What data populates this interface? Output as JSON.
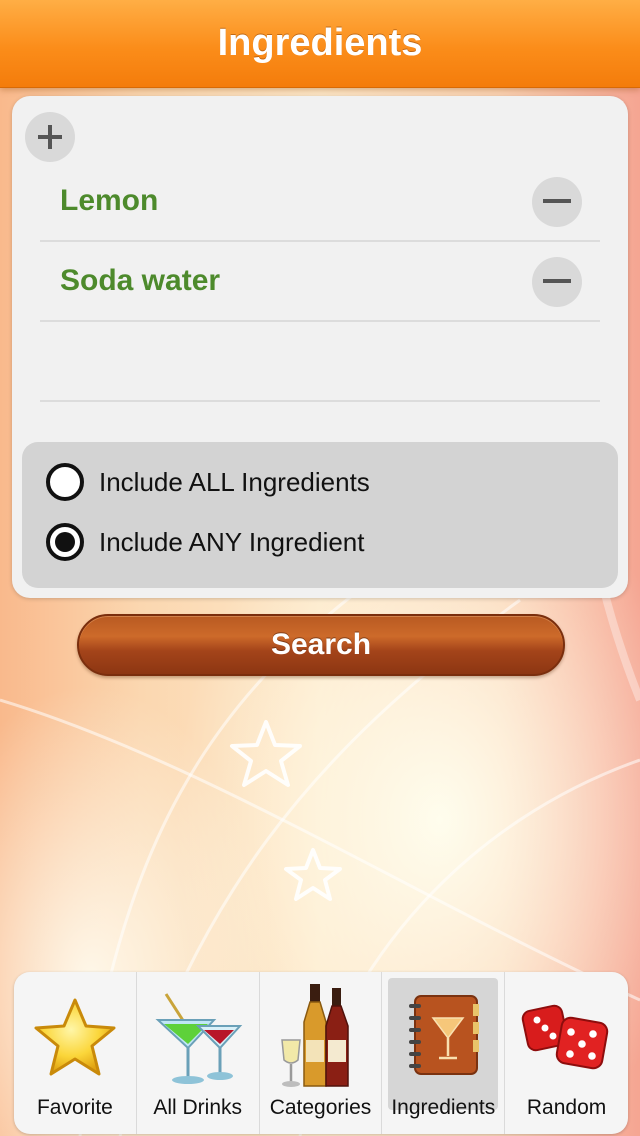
{
  "nav": {
    "title": "Ingredients"
  },
  "ingredients": [
    {
      "name": "Lemon"
    },
    {
      "name": "Soda water"
    }
  ],
  "options": [
    {
      "label": "Include ALL Ingredients",
      "selected": false
    },
    {
      "label": "Include ANY Ingredient",
      "selected": true
    }
  ],
  "search": {
    "label": "Search"
  },
  "tabs": [
    {
      "label": "Favorite",
      "icon": "star-icon",
      "active": false
    },
    {
      "label": "All Drinks",
      "icon": "cocktail-glasses-icon",
      "active": false
    },
    {
      "label": "Categories",
      "icon": "bottles-icon",
      "active": false
    },
    {
      "label": "Ingredients",
      "icon": "recipe-book-icon",
      "active": true
    },
    {
      "label": "Random",
      "icon": "dice-icon",
      "active": false
    }
  ],
  "colors": {
    "nav": "#fb8d1a",
    "ingredient_text": "#4d8a2c",
    "search_button": "#a4441a"
  }
}
